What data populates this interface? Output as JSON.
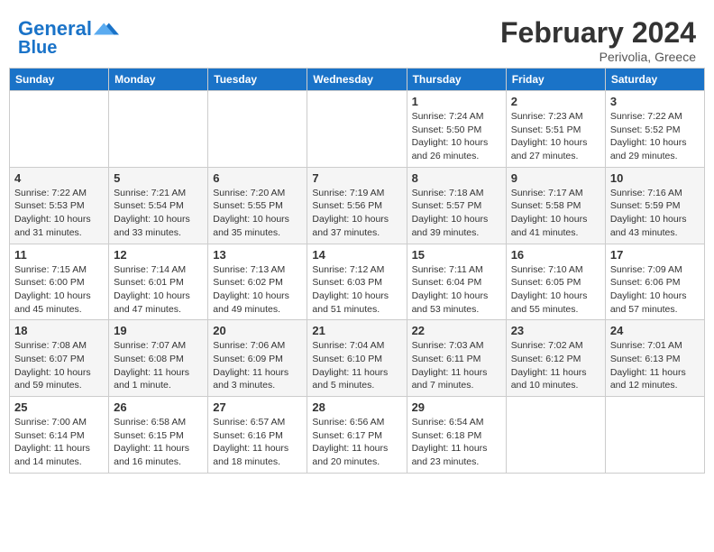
{
  "app": {
    "logo_line1": "General",
    "logo_line2": "Blue"
  },
  "header": {
    "month": "February 2024",
    "location": "Perivolia, Greece"
  },
  "weekdays": [
    "Sunday",
    "Monday",
    "Tuesday",
    "Wednesday",
    "Thursday",
    "Friday",
    "Saturday"
  ],
  "weeks": [
    [
      {
        "num": "",
        "info": ""
      },
      {
        "num": "",
        "info": ""
      },
      {
        "num": "",
        "info": ""
      },
      {
        "num": "",
        "info": ""
      },
      {
        "num": "1",
        "info": "Sunrise: 7:24 AM\nSunset: 5:50 PM\nDaylight: 10 hours\nand 26 minutes."
      },
      {
        "num": "2",
        "info": "Sunrise: 7:23 AM\nSunset: 5:51 PM\nDaylight: 10 hours\nand 27 minutes."
      },
      {
        "num": "3",
        "info": "Sunrise: 7:22 AM\nSunset: 5:52 PM\nDaylight: 10 hours\nand 29 minutes."
      }
    ],
    [
      {
        "num": "4",
        "info": "Sunrise: 7:22 AM\nSunset: 5:53 PM\nDaylight: 10 hours\nand 31 minutes."
      },
      {
        "num": "5",
        "info": "Sunrise: 7:21 AM\nSunset: 5:54 PM\nDaylight: 10 hours\nand 33 minutes."
      },
      {
        "num": "6",
        "info": "Sunrise: 7:20 AM\nSunset: 5:55 PM\nDaylight: 10 hours\nand 35 minutes."
      },
      {
        "num": "7",
        "info": "Sunrise: 7:19 AM\nSunset: 5:56 PM\nDaylight: 10 hours\nand 37 minutes."
      },
      {
        "num": "8",
        "info": "Sunrise: 7:18 AM\nSunset: 5:57 PM\nDaylight: 10 hours\nand 39 minutes."
      },
      {
        "num": "9",
        "info": "Sunrise: 7:17 AM\nSunset: 5:58 PM\nDaylight: 10 hours\nand 41 minutes."
      },
      {
        "num": "10",
        "info": "Sunrise: 7:16 AM\nSunset: 5:59 PM\nDaylight: 10 hours\nand 43 minutes."
      }
    ],
    [
      {
        "num": "11",
        "info": "Sunrise: 7:15 AM\nSunset: 6:00 PM\nDaylight: 10 hours\nand 45 minutes."
      },
      {
        "num": "12",
        "info": "Sunrise: 7:14 AM\nSunset: 6:01 PM\nDaylight: 10 hours\nand 47 minutes."
      },
      {
        "num": "13",
        "info": "Sunrise: 7:13 AM\nSunset: 6:02 PM\nDaylight: 10 hours\nand 49 minutes."
      },
      {
        "num": "14",
        "info": "Sunrise: 7:12 AM\nSunset: 6:03 PM\nDaylight: 10 hours\nand 51 minutes."
      },
      {
        "num": "15",
        "info": "Sunrise: 7:11 AM\nSunset: 6:04 PM\nDaylight: 10 hours\nand 53 minutes."
      },
      {
        "num": "16",
        "info": "Sunrise: 7:10 AM\nSunset: 6:05 PM\nDaylight: 10 hours\nand 55 minutes."
      },
      {
        "num": "17",
        "info": "Sunrise: 7:09 AM\nSunset: 6:06 PM\nDaylight: 10 hours\nand 57 minutes."
      }
    ],
    [
      {
        "num": "18",
        "info": "Sunrise: 7:08 AM\nSunset: 6:07 PM\nDaylight: 10 hours\nand 59 minutes."
      },
      {
        "num": "19",
        "info": "Sunrise: 7:07 AM\nSunset: 6:08 PM\nDaylight: 11 hours\nand 1 minute."
      },
      {
        "num": "20",
        "info": "Sunrise: 7:06 AM\nSunset: 6:09 PM\nDaylight: 11 hours\nand 3 minutes."
      },
      {
        "num": "21",
        "info": "Sunrise: 7:04 AM\nSunset: 6:10 PM\nDaylight: 11 hours\nand 5 minutes."
      },
      {
        "num": "22",
        "info": "Sunrise: 7:03 AM\nSunset: 6:11 PM\nDaylight: 11 hours\nand 7 minutes."
      },
      {
        "num": "23",
        "info": "Sunrise: 7:02 AM\nSunset: 6:12 PM\nDaylight: 11 hours\nand 10 minutes."
      },
      {
        "num": "24",
        "info": "Sunrise: 7:01 AM\nSunset: 6:13 PM\nDaylight: 11 hours\nand 12 minutes."
      }
    ],
    [
      {
        "num": "25",
        "info": "Sunrise: 7:00 AM\nSunset: 6:14 PM\nDaylight: 11 hours\nand 14 minutes."
      },
      {
        "num": "26",
        "info": "Sunrise: 6:58 AM\nSunset: 6:15 PM\nDaylight: 11 hours\nand 16 minutes."
      },
      {
        "num": "27",
        "info": "Sunrise: 6:57 AM\nSunset: 6:16 PM\nDaylight: 11 hours\nand 18 minutes."
      },
      {
        "num": "28",
        "info": "Sunrise: 6:56 AM\nSunset: 6:17 PM\nDaylight: 11 hours\nand 20 minutes."
      },
      {
        "num": "29",
        "info": "Sunrise: 6:54 AM\nSunset: 6:18 PM\nDaylight: 11 hours\nand 23 minutes."
      },
      {
        "num": "",
        "info": ""
      },
      {
        "num": "",
        "info": ""
      }
    ]
  ]
}
